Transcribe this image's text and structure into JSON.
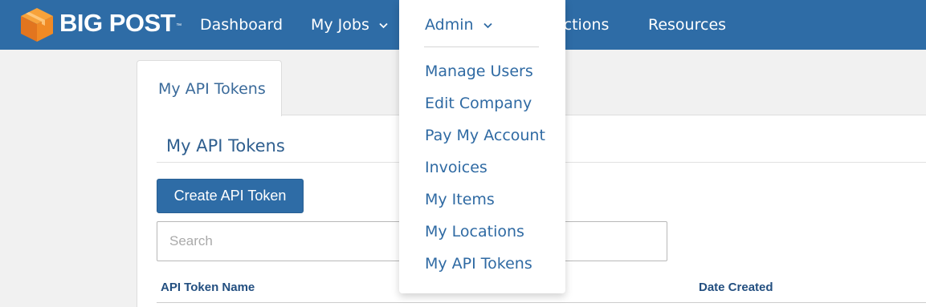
{
  "brand": {
    "name": "BIG POST",
    "trademark": "™"
  },
  "colors": {
    "nav_bg": "#2e6ca6",
    "link": "#2f6aa3",
    "heading": "#2f5f8f",
    "page_bg": "#f1f1f1"
  },
  "nav": {
    "items": [
      {
        "label": "Dashboard"
      },
      {
        "label": "My Jobs",
        "has_dropdown": true
      },
      {
        "label": "actions",
        "note": "partially hidden behind open dropdown"
      },
      {
        "label": "Resources"
      }
    ]
  },
  "admin_menu": {
    "label": "Admin",
    "items": [
      {
        "label": "Manage Users"
      },
      {
        "label": "Edit Company"
      },
      {
        "label": "Pay My Account"
      },
      {
        "label": "Invoices"
      },
      {
        "label": "My Items"
      },
      {
        "label": "My Locations"
      },
      {
        "label": "My API Tokens"
      }
    ]
  },
  "page": {
    "tab_label": "My API Tokens",
    "section_title": "My API Tokens",
    "create_button": "Create API Token",
    "search": {
      "placeholder": "Search",
      "value": ""
    },
    "table": {
      "columns": [
        "API Token Name",
        "Date Created"
      ]
    }
  },
  "icons": {
    "logo": "box-icon",
    "dropdown": "chevron-down-icon"
  }
}
